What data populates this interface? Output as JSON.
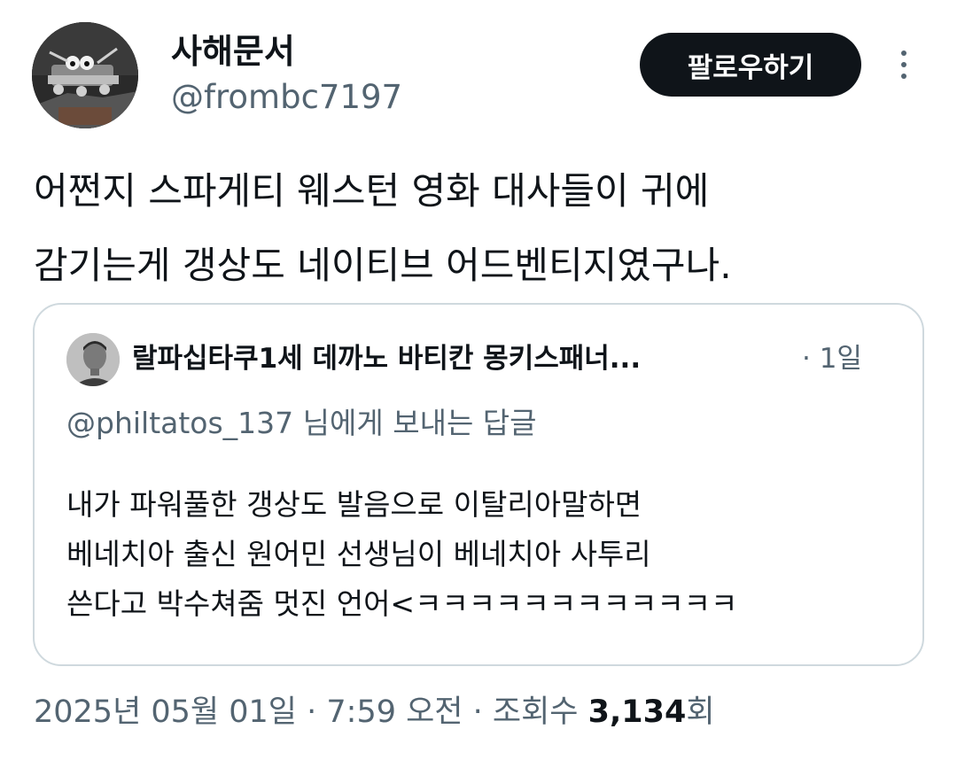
{
  "author": {
    "display_name": "사해문서",
    "handle": "@frombc7197"
  },
  "follow_label": "팔로우하기",
  "tweet_lines": [
    "어쩐지 스파게티 웨스턴 영화 대사들이 귀에",
    "감기는게 갱상도 네이티브 어드벤티지였구나."
  ],
  "quote": {
    "author_name": "랄파십타쿠1세 데까노 바티칸 몽키스패너...",
    "time": "· 1일",
    "reply_to": "@philtatos_137 님에게 보내는 답글",
    "body_lines": [
      "내가 파워풀한 갱상도 발음으로 이탈리아말하면",
      "베네치아 출신 원어민 선생님이 베네치아 사투리",
      "쓴다고 박수쳐줌 멋진 언어<ㅋㅋㅋㅋㅋㅋㅋㅋㅋㅋㅋㅋ"
    ]
  },
  "meta": {
    "date": "2025년 05월 01일",
    "sep1": " · ",
    "time": "7:59 오전",
    "sep2": " · ",
    "views_label": "조회수 ",
    "views_count": "3,134",
    "views_suffix": "회"
  },
  "colors": {
    "text": "#0f1419",
    "secondary": "#536471",
    "border": "#cfd9de",
    "button_bg": "#0f1419",
    "button_text": "#ffffff"
  },
  "icons": {
    "more": "more-vertical-icon"
  }
}
